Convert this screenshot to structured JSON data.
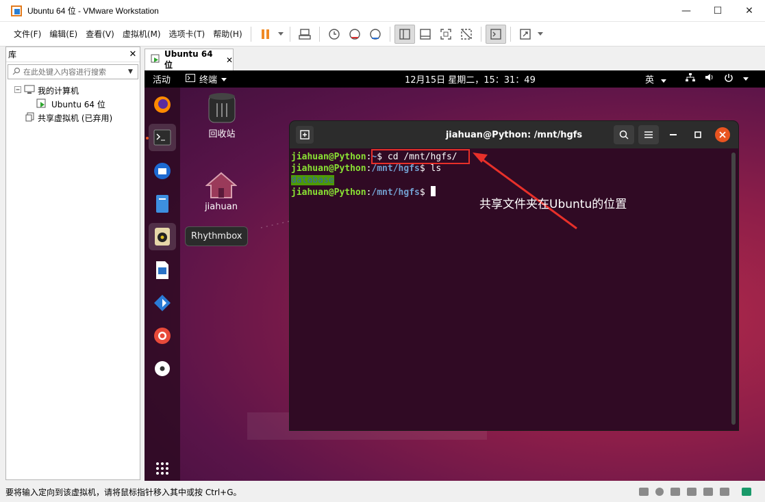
{
  "window": {
    "title": "Ubuntu 64 位 - VMware Workstation",
    "minimize": "—",
    "maximize": "☐",
    "close": "✕"
  },
  "menu": [
    "文件(F)",
    "编辑(E)",
    "查看(V)",
    "虚拟机(M)",
    "选项卡(T)",
    "帮助(H)"
  ],
  "library": {
    "title": "库",
    "close": "✕",
    "search_placeholder": "在此处键入内容进行搜索",
    "tree": {
      "root": "我的计算机",
      "vm": "Ubuntu 64 位",
      "shared": "共享虚拟机 (已弃用)"
    }
  },
  "vm_tab": {
    "label": "Ubuntu 64 位",
    "close": "✕"
  },
  "guest": {
    "topbar": {
      "activities": "活动",
      "app_menu": "终端",
      "clock": "12月15日 星期二，15：31：49",
      "ime": "英"
    },
    "desktop": {
      "trash_label": "回收站",
      "home_label": "jiahuan"
    },
    "tooltip": "Rhythmbox",
    "terminal": {
      "title": "jiahuan@Python: /mnt/hgfs",
      "lines": {
        "l1_user": "jiahuan@Python",
        "l1_sep": ":",
        "l1_path": "~",
        "l1_cmd": "$ cd /mnt/hgfs/",
        "l2_user": "jiahuan@Python",
        "l2_sep": ":",
        "l2_path": "/mnt/hgfs",
        "l2_cmd": "$ ls",
        "l3_dir": "database",
        "l4_user": "jiahuan@Python",
        "l4_sep": ":",
        "l4_path": "/mnt/hgfs",
        "l4_cmd": "$ "
      }
    },
    "annotation": "共享文件夹在Ubuntu的位置"
  },
  "status": {
    "message": "要将输入定向到该虚拟机，请将鼠标指针移入其中或按 Ctrl+G。"
  },
  "colors": {
    "ubuntu_orange": "#e95420",
    "terminal_bg": "#300a24",
    "prompt_user": "#8ae234",
    "prompt_path": "#729fcf",
    "annotation_red": "#e8302a"
  }
}
